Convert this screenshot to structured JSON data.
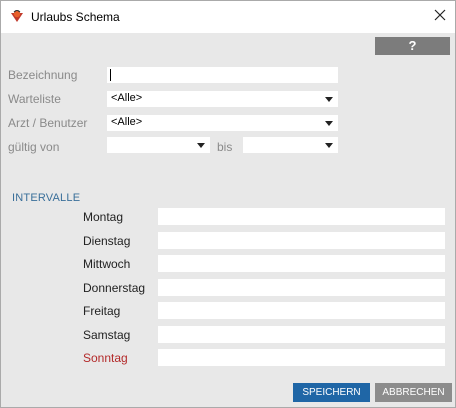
{
  "window": {
    "title": "Urlaubs Schema"
  },
  "toolbar": {
    "help_label": "?"
  },
  "form": {
    "bezeichnung_label": "Bezeichnung",
    "bezeichnung_value": "",
    "warteliste_label": "Warteliste",
    "warteliste_value": "<Alle>",
    "arzt_label": "Arzt / Benutzer",
    "arzt_value": "<Alle>",
    "gueltig_label": "gültig von",
    "gueltig_von_value": "",
    "bis_label": "bis",
    "gueltig_bis_value": ""
  },
  "intervalle": {
    "title": "INTERVALLE",
    "days": [
      "Montag",
      "Dienstag",
      "Mittwoch",
      "Donnerstag",
      "Freitag",
      "Samstag",
      "Sonntag"
    ]
  },
  "footer": {
    "save_label": "SPEICHERN",
    "cancel_label": "ABBRECHEN"
  },
  "colors": {
    "accent": "#1f66a6",
    "sunday": "#b32a2a",
    "section_title": "#3a6f9a",
    "panel": "#e8e8e8"
  }
}
